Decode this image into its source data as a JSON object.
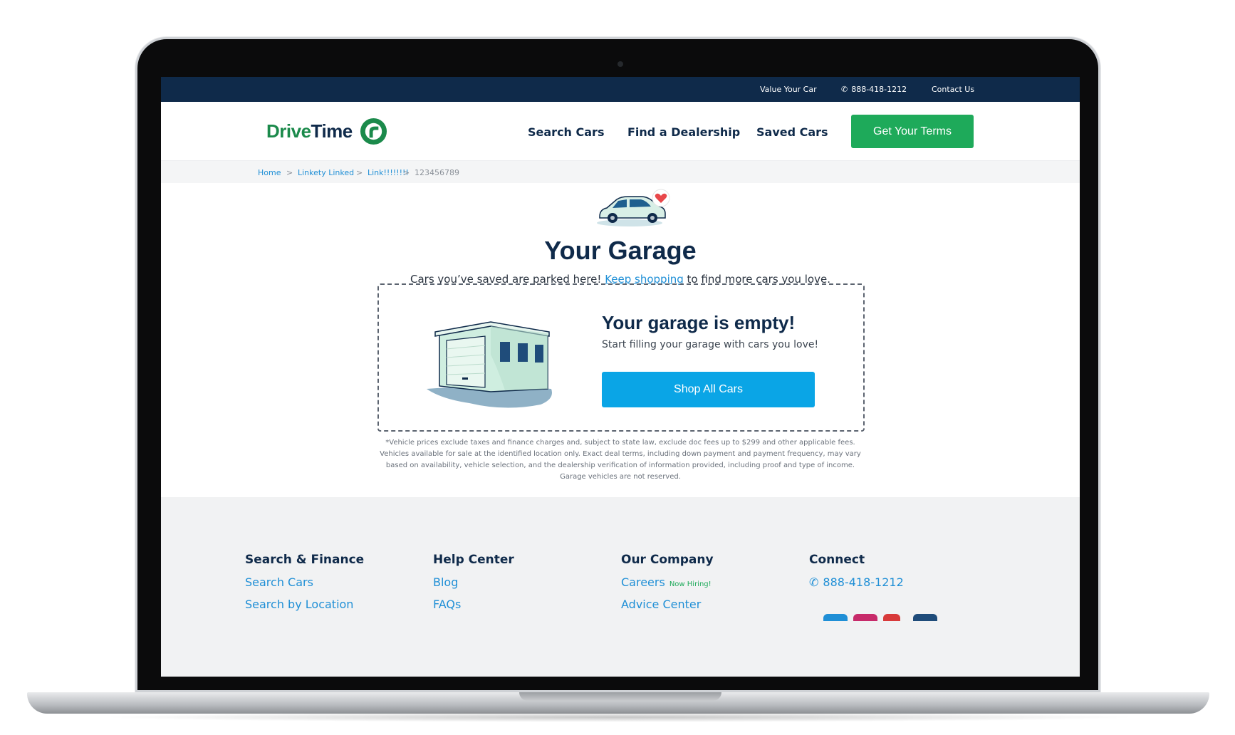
{
  "topbar": {
    "value_car": "Value Your Car",
    "phone": "888-418-1212",
    "contact": "Contact Us",
    "phone_icon": "phone-icon"
  },
  "header": {
    "logo_part1": "Drive",
    "logo_part2": "Time",
    "nav": [
      "Search Cars",
      "Find a Dealership",
      "Saved Cars"
    ],
    "cta": "Get Your Terms"
  },
  "breadcrumb": {
    "items": [
      "Home",
      "Linkety Linked",
      "Link!!!!!!!!",
      "123456789"
    ],
    "separator": ">"
  },
  "hero": {
    "title": "Your Garage",
    "subtitle_before": "Cars you’ve saved are parked here! ",
    "subtitle_link": "Keep shopping",
    "subtitle_after": " to find more cars you love."
  },
  "empty_state": {
    "title": "Your garage is empty!",
    "subtitle": "Start filling your garage with cars you love!",
    "button": "Shop All Cars"
  },
  "disclaimer": "*Vehicle prices exclude taxes and finance charges and, subject to state law, exclude doc fees up to $299 and other applicable fees. Vehicles available for sale at the identified location only. Exact deal terms, including down payment and payment frequency, may vary based on availability, vehicle selection, and the dealership verification of information provided, including proof and type of income. Garage vehicles are not reserved.",
  "footer": {
    "columns": [
      {
        "heading": "Search & Finance",
        "links": [
          "Search Cars",
          "Search by Location"
        ]
      },
      {
        "heading": "Help Center",
        "links": [
          "Blog",
          "FAQs"
        ]
      },
      {
        "heading": "Our Company",
        "links": [
          "Careers",
          "Advice Center"
        ],
        "badge": "Now Hiring!"
      },
      {
        "heading": "Connect",
        "links": [
          "888-418-1212"
        ]
      }
    ]
  },
  "colors": {
    "navy": "#0f2a4a",
    "green": "#1eaa5a",
    "blue": "#0aa5e6",
    "link": "#1f8fd6"
  }
}
